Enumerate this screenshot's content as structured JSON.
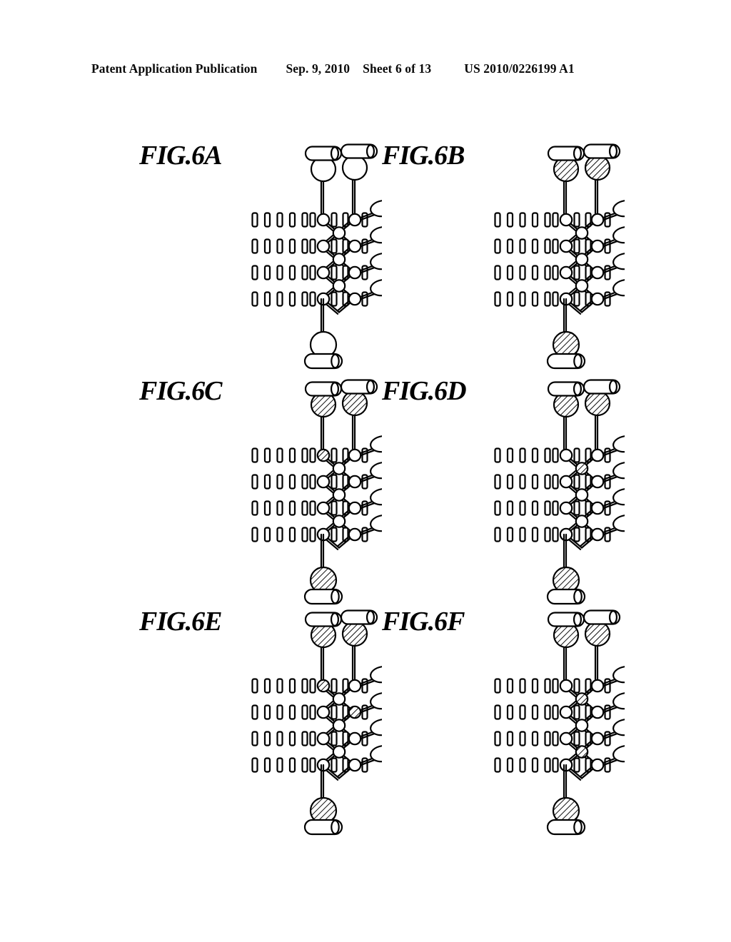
{
  "header": {
    "publication": "Patent Application Publication",
    "date": "Sep. 9, 2010",
    "sheet": "Sheet 6 of 13",
    "number": "US 2010/0226199 A1"
  },
  "figures": [
    {
      "id": "fig-6a",
      "label": "FIG.6A"
    },
    {
      "id": "fig-6b",
      "label": "FIG.6B"
    },
    {
      "id": "fig-6c",
      "label": "FIG.6C"
    },
    {
      "id": "fig-6d",
      "label": "FIG.6D"
    },
    {
      "id": "fig-6e",
      "label": "FIG.6E"
    },
    {
      "id": "fig-6f",
      "label": "FIG.6F"
    }
  ],
  "diagram": {
    "description": "Schematic cross-section of a multi-layer recording-head / lattice structure repeated six times with differing hatched (shaded) elements.",
    "stroke_color": "#000000",
    "fill_color": "#ffffff",
    "hatch_color": "#000000",
    "rows": 4,
    "free_bars_per_row": [
      6,
      5,
      5,
      5
    ],
    "right_ellipses": 4,
    "variants": {
      "fig-6a": {
        "hatched": []
      },
      "fig-6b": {
        "hatched": [
          "top-left",
          "top-right",
          "bottom"
        ]
      },
      "fig-6c": {
        "hatched": [
          "top-left",
          "top-right",
          "node-L1",
          "bottom"
        ]
      },
      "fig-6d": {
        "hatched": [
          "top-left",
          "top-right",
          "node-C2",
          "bottom"
        ]
      },
      "fig-6e": {
        "hatched": [
          "top-left",
          "top-right",
          "node-L1",
          "node-R2",
          "bottom"
        ]
      },
      "fig-6f": {
        "hatched": [
          "top-left",
          "top-right",
          "node-C2",
          "node-C4",
          "bottom"
        ]
      }
    }
  }
}
